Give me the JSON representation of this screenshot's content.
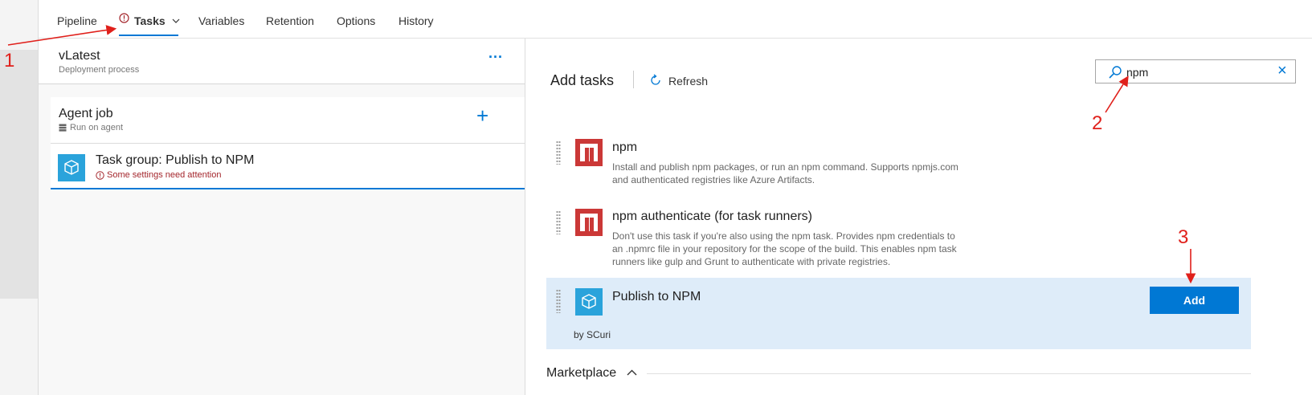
{
  "tabs": [
    {
      "label": "Pipeline"
    },
    {
      "label": "Tasks"
    },
    {
      "label": "Variables"
    },
    {
      "label": "Retention"
    },
    {
      "label": "Options"
    },
    {
      "label": "History"
    }
  ],
  "process": {
    "title": "vLatest",
    "subtitle": "Deployment process",
    "more_glyph": "..."
  },
  "agent_job": {
    "title": "Agent job",
    "subtitle": "Run on agent",
    "add_glyph": "+"
  },
  "task_group": {
    "title": "Task group: Publish to NPM",
    "warning": "Some settings need attention"
  },
  "add_tasks": {
    "title": "Add tasks",
    "refresh_label": "Refresh"
  },
  "search": {
    "value": "npm",
    "clear_glyph": "×"
  },
  "tasks": [
    {
      "title": "npm",
      "desc_lines": [
        "Install and publish npm packages, or run an npm command. Supports npmjs.com",
        "and authenticated registries like Azure Artifacts."
      ]
    },
    {
      "title": "npm authenticate (for task runners)",
      "desc_lines": [
        "Don't use this task if you're also using the npm task. Provides npm credentials to",
        "an .npmrc file in your repository for the scope of the build. This enables npm task",
        "runners like gulp and Grunt to authenticate with private registries."
      ]
    },
    {
      "title": "Publish to NPM",
      "author": "by SCuri",
      "add_label": "Add"
    }
  ],
  "marketplace": {
    "label": "Marketplace"
  },
  "annotations": {
    "step1": "1",
    "step2": "2",
    "step3": "3"
  },
  "colors": {
    "accent": "#0078d4",
    "warning": "#a4262c",
    "npm_red": "#cb3837",
    "task_group_blue": "#2aa3db",
    "selected_bg": "#deecf9",
    "annotation_red": "#e0201b"
  }
}
